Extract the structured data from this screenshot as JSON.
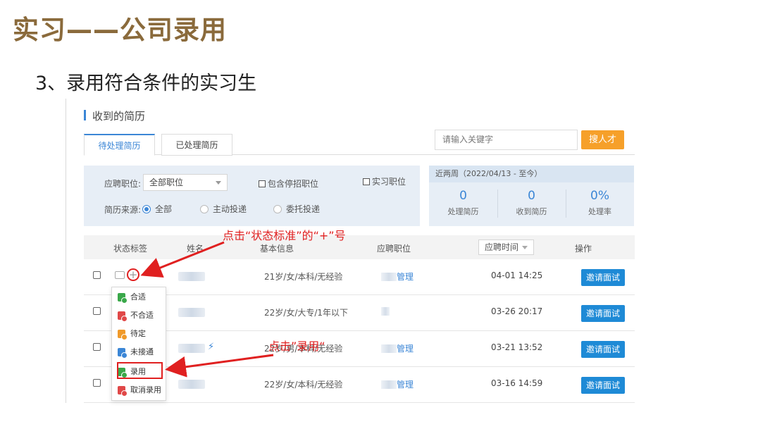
{
  "slide": {
    "title": "实习——公司录用",
    "subtitle": "3、录用符合条件的实习生"
  },
  "panel": {
    "section_title": "收到的简历",
    "tabs": [
      {
        "label": "待处理简历",
        "active": true
      },
      {
        "label": "已处理简历",
        "active": false
      }
    ],
    "search": {
      "placeholder": "请输入关键字",
      "button": "搜人才"
    },
    "filters": {
      "position_label": "应聘职位:",
      "position_value": "全部职位",
      "include_closed": "包含停招职位",
      "intern_positions": "实习职位",
      "source_label": "简历来源:",
      "source_options": [
        "全部",
        "主动投递",
        "委托投递"
      ],
      "source_selected": "全部"
    },
    "stats": {
      "period": "近两周（2022/04/13 - 至今）",
      "items": [
        {
          "value": "0",
          "label": "处理简历"
        },
        {
          "value": "0",
          "label": "收到简历"
        },
        {
          "value": "0%",
          "label": "处理率"
        }
      ]
    },
    "table": {
      "headers": [
        "状态标签",
        "姓名",
        "基本信息",
        "应聘职位",
        "操作"
      ],
      "sort_label": "应聘时间",
      "rows": [
        {
          "info": "21岁/女/本科/无经验",
          "position_suffix": "管理",
          "time": "04-01 14:25",
          "action": "邀请面试"
        },
        {
          "info": "22岁/女/大专/1年以下",
          "position_suffix": "",
          "time": "03-26 20:17",
          "action": "邀请面试"
        },
        {
          "info": "22岁/男/本科/无经验",
          "position_suffix": "管理",
          "time": "03-21 13:52",
          "action": "邀请面试"
        },
        {
          "info": "22岁/女/本科/无经验",
          "position_suffix": "管理",
          "time": "03-16 14:59",
          "action": "邀请面试"
        }
      ]
    },
    "status_menu": {
      "items": [
        {
          "label": "合适",
          "color": "#3aa84a"
        },
        {
          "label": "不合适",
          "color": "#e04848"
        },
        {
          "label": "待定",
          "color": "#f09a2a"
        },
        {
          "label": "未接通",
          "color": "#3b86d6"
        },
        {
          "label": "录用",
          "color": "#3aa84a"
        },
        {
          "label": "取消录用",
          "color": "#e04848"
        }
      ],
      "highlighted": "录用"
    }
  },
  "annotations": {
    "click_plus": "点击“状态标准”的“+”号",
    "click_hire": "点击”录用“"
  },
  "colors": {
    "accent": "#3b86d6",
    "orange": "#f6a02a",
    "annotation": "#e02020",
    "title": "#8a6a3b"
  }
}
